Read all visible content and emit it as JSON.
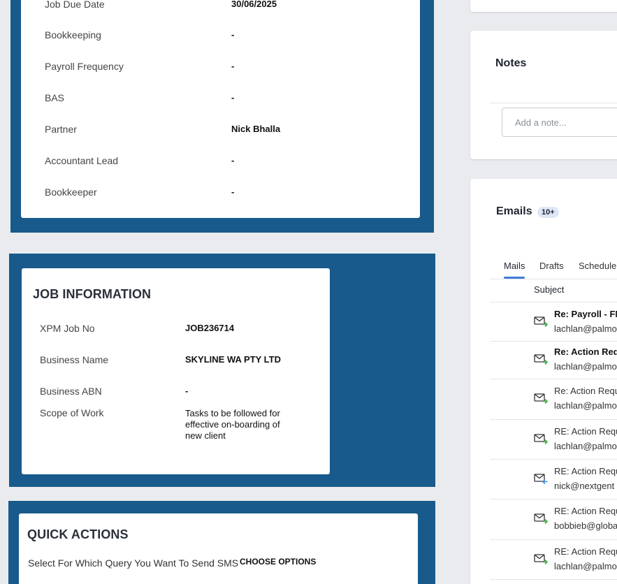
{
  "client_details": {
    "rows": [
      {
        "label": "Job Due Date",
        "value": "30/06/2025"
      },
      {
        "label": "Bookkeeping",
        "value": "-"
      },
      {
        "label": "Payroll Frequency",
        "value": "-"
      },
      {
        "label": "BAS",
        "value": "-"
      },
      {
        "label": "Partner",
        "value": "Nick Bhalla"
      },
      {
        "label": "Accountant Lead",
        "value": "-"
      },
      {
        "label": "Bookkeeper",
        "value": "-"
      }
    ]
  },
  "job_information": {
    "title": "JOB INFORMATION",
    "rows": [
      {
        "label": "XPM Job No",
        "value": "JOB236714"
      },
      {
        "label": "Business Name",
        "value": "SKYLINE WA PTY LTD"
      },
      {
        "label": "Business ABN",
        "value": "-"
      },
      {
        "label": "Scope of Work",
        "value": "Tasks to be followed for effective on-boarding of new client"
      }
    ]
  },
  "quick_actions": {
    "title": "QUICK ACTIONS",
    "sms_label": "Select For Which Query You Want To Send SMS",
    "choose_label": "CHOOSE OPTIONS"
  },
  "notes": {
    "title": "Notes",
    "placeholder": "Add a note..."
  },
  "emails": {
    "title": "Emails",
    "badge": "10+",
    "tabs": [
      "Mails",
      "Drafts",
      "Schedule"
    ],
    "active_tab": "Mails",
    "column_subject": "Subject",
    "items": [
      {
        "subject": "Re: Payroll - FN",
        "from": "lachlan@palmo",
        "bold": true,
        "icon": "mail-outgoing-icon"
      },
      {
        "subject": "Re: Action Requ",
        "from": "lachlan@palmo",
        "bold": true,
        "icon": "mail-outgoing-icon"
      },
      {
        "subject": "Re: Action Requ",
        "from": "lachlan@palmo",
        "bold": false,
        "icon": "mail-outgoing-icon"
      },
      {
        "subject": "RE: Action Requ",
        "from": "lachlan@palmo",
        "bold": false,
        "icon": "mail-outgoing-icon"
      },
      {
        "subject": "RE: Action Requ",
        "from": "nick@nextgent",
        "bold": false,
        "icon": "mail-incoming-icon"
      },
      {
        "subject": "RE: Action Requ",
        "from": "bobbieb@globa",
        "bold": false,
        "icon": "mail-outgoing-icon"
      },
      {
        "subject": "RE: Action Requ",
        "from": "lachlan@palmo",
        "bold": false,
        "icon": "mail-outgoing-icon"
      }
    ]
  },
  "colors": {
    "panel_blue": "#175a8b",
    "background": "#eaebee",
    "tab_accent": "#3b7dd8",
    "outgoing_arrow": "#3fae4a",
    "incoming_arrow": "#3b8fe0"
  }
}
